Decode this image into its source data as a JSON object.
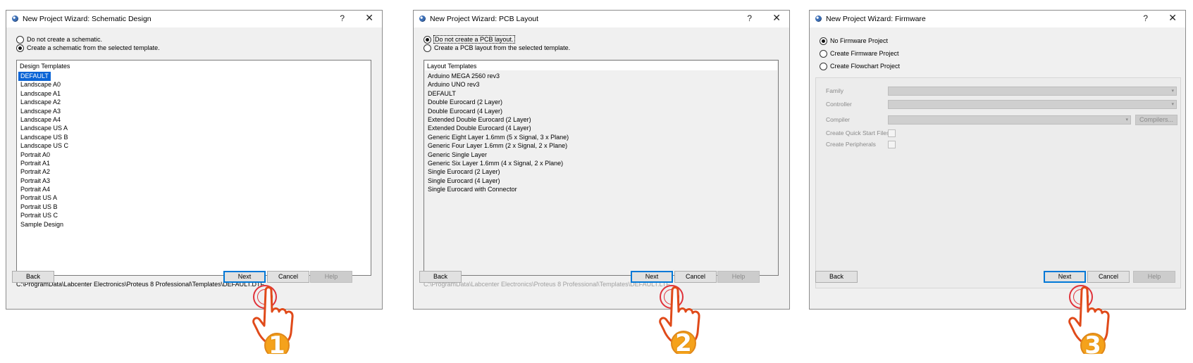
{
  "dialogs": [
    {
      "title": "New Project Wizard: Schematic Design",
      "radio_options": [
        {
          "label": "Do not create a schematic.",
          "checked": false
        },
        {
          "label": "Create a schematic from the selected template.",
          "checked": true
        }
      ],
      "list_header": "Design Templates",
      "templates": [
        "DEFAULT",
        "Landscape A0",
        "Landscape A1",
        "Landscape A2",
        "Landscape A3",
        "Landscape A4",
        "Landscape US A",
        "Landscape US B",
        "Landscape US C",
        "Portrait A0",
        "Portrait A1",
        "Portrait A2",
        "Portrait A3",
        "Portrait A4",
        "Portrait US A",
        "Portrait US B",
        "Portrait US C",
        "Sample Design"
      ],
      "selected_template": "DEFAULT",
      "path": "C:\\ProgramData\\Labcenter Electronics\\Proteus 8 Professional\\Templates\\DEFAULT.DTF",
      "buttons": {
        "back": "Back",
        "next": "Next",
        "cancel": "Cancel",
        "help": "Help"
      }
    },
    {
      "title": "New Project Wizard: PCB Layout",
      "radio_options": [
        {
          "label": "Do not create a PCB layout.",
          "checked": true
        },
        {
          "label": "Create a PCB layout from the selected template.",
          "checked": false
        }
      ],
      "list_header": "Layout Templates",
      "templates": [
        "Arduino MEGA 2560 rev3",
        "Arduino UNO rev3",
        "DEFAULT",
        "Double Eurocard (2 Layer)",
        "Double Eurocard (4 Layer)",
        "Extended Double Eurocard (2 Layer)",
        "Extended Double Eurocard (4 Layer)",
        "Generic Eight Layer 1.6mm (5 x Signal, 3 x Plane)",
        "Generic Four Layer 1.6mm (2 x Signal, 2 x Plane)",
        "Generic Single Layer",
        "Generic Six Layer 1.6mm (4 x Signal, 2 x Plane)",
        "Single Eurocard (2 Layer)",
        "Single Eurocard (4 Layer)",
        "Single Eurocard with Connector"
      ],
      "path": "C:\\ProgramData\\Labcenter Electronics\\Proteus 8 Professional\\Templates\\DEFAULT.LTF",
      "buttons": {
        "back": "Back",
        "next": "Next",
        "cancel": "Cancel",
        "help": "Help"
      }
    },
    {
      "title": "New Project Wizard: Firmware",
      "radio_options": [
        {
          "label": "No Firmware Project",
          "checked": true
        },
        {
          "label": "Create Firmware Project",
          "checked": false
        },
        {
          "label": "Create Flowchart Project",
          "checked": false
        }
      ],
      "fields": {
        "family": "Family",
        "controller": "Controller",
        "compiler": "Compiler",
        "compilers_button": "Compilers...",
        "quick_start": "Create Quick Start Files",
        "peripherals": "Create Peripherals"
      },
      "buttons": {
        "back": "Back",
        "next": "Next",
        "cancel": "Cancel",
        "help": "Help"
      }
    }
  ],
  "title_help_glyph": "?",
  "title_close_glyph": "✕",
  "step_badges": [
    "1",
    "2",
    "3"
  ],
  "colors": {
    "selection": "#0a64d6",
    "default_button_border": "#0078d7",
    "badge_fill": "#f5a21b",
    "hand_outline": "#e04a1a",
    "click_ring": "#e0323a"
  }
}
